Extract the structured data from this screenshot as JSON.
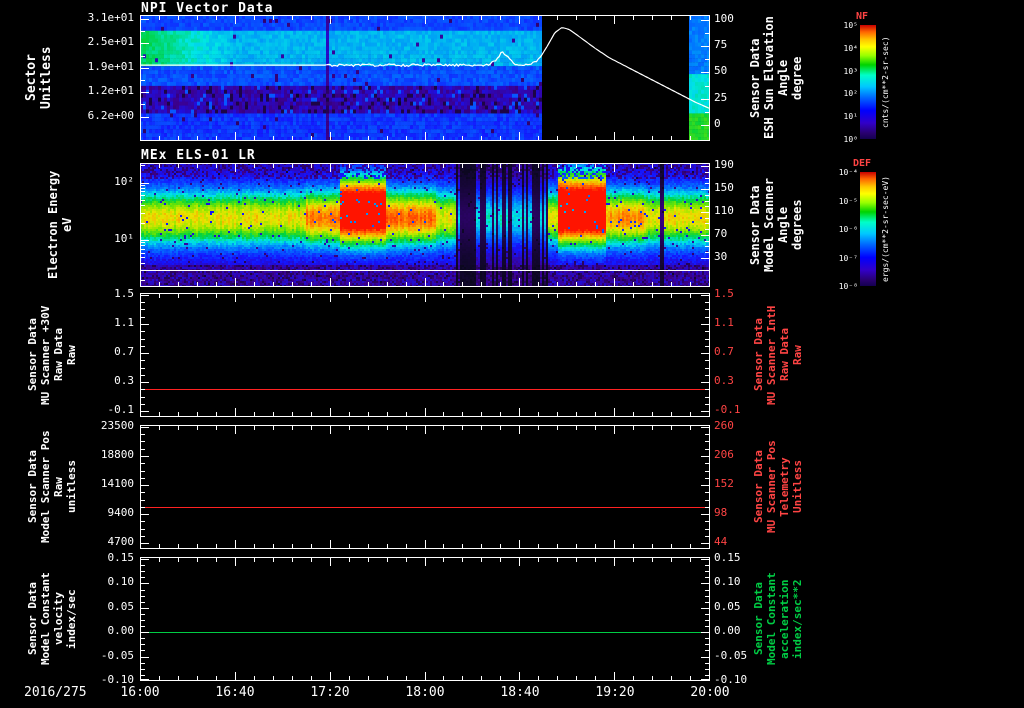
{
  "colors": {
    "background": "#000000",
    "axis": "#ffffff",
    "series_red": "#ff2222",
    "series_green": "#00cc44",
    "colorbar_title_red": "#ff4444"
  },
  "x_axis": {
    "date_label": "2016/275",
    "tick_labels": [
      "16:00",
      "16:40",
      "17:20",
      "18:00",
      "18:40",
      "19:20",
      "20:00"
    ],
    "range_minutes": [
      0,
      240
    ]
  },
  "panels": [
    {
      "title": "NPI Vector Data",
      "left_label_lines": [
        "Sector",
        "Unitless"
      ],
      "left_tick_labels": [
        "3.1e+01",
        "2.5e+01",
        "1.9e+01",
        "1.2e+01",
        "6.2e+00"
      ],
      "right_tick_labels": [
        "100",
        "75",
        "50",
        "25",
        "0"
      ],
      "right_tick_color": "#ffffff",
      "right_label_lines": [
        "Sensor Data",
        "ESH Sun Elevation",
        "Angle",
        "degree"
      ],
      "right_label_color": "#ffffff",
      "colorbar": {
        "title": "NF",
        "tick_labels": [
          "10⁵",
          "10⁴",
          "10³",
          "10²",
          "10¹",
          "10⁰"
        ],
        "units": "cnts/(cm**2-sr-sec)"
      }
    },
    {
      "title": "MEx ELS-01 LR",
      "left_label_lines": [
        "Electron Energy",
        "eV"
      ],
      "left_tick_labels": [
        "10²",
        "10¹"
      ],
      "right_tick_labels": [
        "190",
        "150",
        "110",
        "70",
        "30"
      ],
      "right_tick_color": "#ffffff",
      "right_label_lines": [
        "Sensor Data",
        "Model Scanner",
        "Angle",
        "degrees"
      ],
      "right_label_color": "#ffffff",
      "colorbar": {
        "title": "DEF",
        "tick_labels": [
          "10⁻⁴",
          "10⁻⁵",
          "10⁻⁶",
          "10⁻⁷",
          "10⁻⁸"
        ],
        "units": "ergs/(cm**2-sr-sec-eV)"
      }
    },
    {
      "title": "",
      "left_label_lines": [
        "Sensor Data",
        "MU Scanner +30V",
        "Raw Data",
        "Raw"
      ],
      "left_tick_labels": [
        "1.5",
        "1.1",
        "0.7",
        "0.3",
        "-0.1"
      ],
      "right_tick_labels": [
        "1.5",
        "1.1",
        "0.7",
        "0.3",
        "-0.1"
      ],
      "right_tick_color": "#ff4444",
      "right_label_lines": [
        "Sensor Data",
        "MU Scanner IntH",
        "Raw Data",
        "Raw"
      ],
      "right_label_color": "#ff4444"
    },
    {
      "title": "",
      "left_label_lines": [
        "Sensor Data",
        "Model Scanner Pos",
        "Raw",
        "unitless"
      ],
      "left_tick_labels": [
        "23500",
        "18800",
        "14100",
        "9400",
        "4700"
      ],
      "right_tick_labels": [
        "260",
        "206",
        "152",
        "98",
        "44"
      ],
      "right_tick_color": "#ff4444",
      "right_label_lines": [
        "Sensor Data",
        "MU Scanner Pos",
        "Telemetry",
        "Unitless"
      ],
      "right_label_color": "#ff4444"
    },
    {
      "title": "",
      "left_label_lines": [
        "Sensor Data",
        "Model Constant",
        "velocity",
        "index/sec"
      ],
      "left_tick_labels": [
        "0.15",
        "0.10",
        "0.05",
        "0.00",
        "-0.05",
        "-0.10"
      ],
      "right_tick_labels": [
        "0.15",
        "0.10",
        "0.05",
        "0.00",
        "-0.05",
        "-0.10"
      ],
      "right_tick_color": "#ffffff",
      "right_label_lines": [
        "Sensor Data",
        "Model Constant",
        "acceleration",
        "index/sec**2"
      ],
      "right_label_color": "#00cc44"
    }
  ],
  "chart_data": [
    {
      "type": "heatmap",
      "title": "NPI Vector Data",
      "x_range_minutes": [
        0,
        240
      ],
      "sector_range": [
        0,
        32
      ],
      "sector_ticks": [
        31,
        25,
        19,
        12,
        6.2
      ],
      "bright_band_sectors": [
        19,
        28
      ],
      "dark_speckle_band_sectors": [
        7,
        13
      ],
      "bright_until_minute": 40,
      "data_gap_minutes": [
        169,
        231
      ],
      "colorbar_quantity": "NF cnts/(cm**2-sr-sec)",
      "overlay_line": {
        "name": "ESH Sun Elevation Angle",
        "units": "degree",
        "color": "#ffffff",
        "axis_range": [
          0,
          100
        ],
        "points": [
          [
            0,
            57
          ],
          [
            30,
            57
          ],
          [
            60,
            57
          ],
          [
            90,
            57
          ],
          [
            120,
            57
          ],
          [
            140,
            57
          ],
          [
            147,
            57
          ],
          [
            150,
            62
          ],
          [
            153,
            70
          ],
          [
            156,
            63
          ],
          [
            159,
            57
          ],
          [
            163,
            57
          ],
          [
            166,
            59
          ],
          [
            169,
            65
          ],
          [
            172,
            76
          ],
          [
            175,
            88
          ],
          [
            178,
            93
          ],
          [
            181,
            91
          ],
          [
            186,
            83
          ],
          [
            192,
            73
          ],
          [
            198,
            64
          ],
          [
            204,
            57
          ],
          [
            210,
            50
          ],
          [
            216,
            43
          ],
          [
            222,
            36
          ],
          [
            228,
            29
          ],
          [
            234,
            22
          ],
          [
            240,
            16
          ]
        ]
      }
    },
    {
      "type": "heatmap",
      "title": "MEx ELS-01 LR",
      "x_range_minutes": [
        0,
        240
      ],
      "energy_range_ev": [
        1.5,
        220
      ],
      "log_y": true,
      "energy_ticks_ev": [
        100,
        10
      ],
      "main_band_center_ev": 24,
      "hot_regions_minutes": [
        [
          84,
          104
        ],
        [
          176,
          196
        ]
      ],
      "dropout_minutes": [
        133,
        172
      ],
      "overlay_line_ev": 3,
      "colorbar_quantity": "DEF ergs/(cm**2-sr-sec-eV)"
    },
    {
      "type": "line",
      "series_name": "MU Scanner +30V Raw Data",
      "color": "#ff2222",
      "constant_value": 0.2,
      "y_ticks": [
        1.5,
        1.1,
        0.7,
        0.3,
        -0.1
      ]
    },
    {
      "type": "line",
      "series_name": "Model Scanner Pos Raw",
      "color": "#ff2222",
      "constant_value": 10500,
      "y_ticks": [
        23500,
        18800,
        14100,
        9400,
        4700
      ],
      "right_y_ticks": [
        260,
        206,
        152,
        98,
        44
      ]
    },
    {
      "type": "line",
      "series_name": "Model Constant velocity",
      "color": "#00cc44",
      "constant_value": 0.0,
      "y_ticks": [
        0.15,
        0.1,
        0.05,
        0.0,
        -0.05,
        -0.1
      ]
    }
  ]
}
